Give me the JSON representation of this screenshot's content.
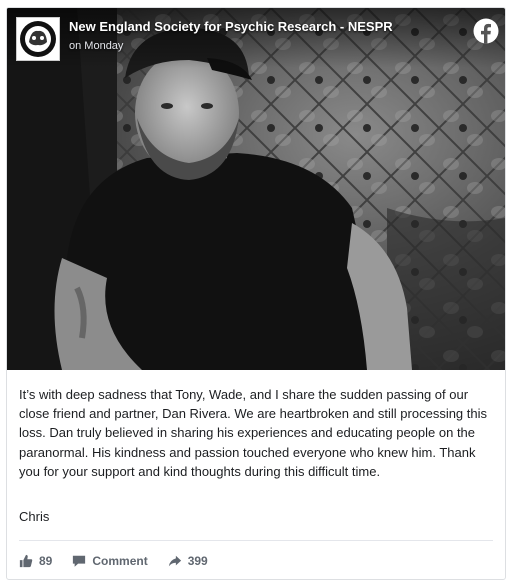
{
  "post": {
    "page_name": "New England Society for Psychic Research - NESPR",
    "timestamp": "on Monday",
    "text": "It’s with deep sadness that Tony, Wade, and I share the sudden passing of our close friend and partner, Dan Rivera. We are heartbroken and still processing this loss. Dan truly believed in sharing his experiences and educating people on the paranormal. His kindness and passion touched everyone who knew him. Thank you for your support and kind thoughts during this difficult time.",
    "signoff": "Chris"
  },
  "actions": {
    "like_count": "89",
    "comment_label": "Comment",
    "share_count": "399"
  },
  "icons": {
    "platform_logo": "facebook-icon",
    "like": "thumbs-up-icon",
    "comment": "comment-icon",
    "share": "share-arrow-icon"
  },
  "colors": {
    "facebook_logo_bg": "#ffffff",
    "action_text": "#606770",
    "body_text": "#1c1e21"
  }
}
